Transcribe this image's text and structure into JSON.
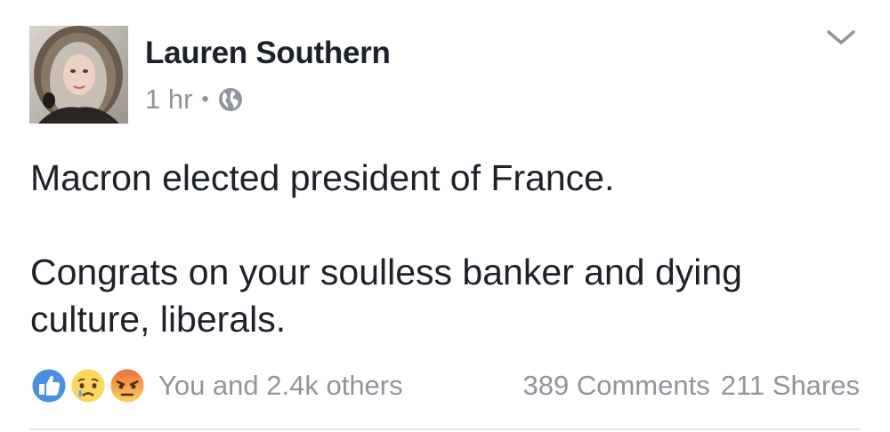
{
  "post": {
    "author": "Lauren Southern",
    "timestamp": "1 hr",
    "separator": "•",
    "audience_icon": "globe-icon",
    "menu_icon": "chevron-down-icon",
    "paragraphs": [
      "Macron elected president of France.",
      "Congrats on your soulless banker and dying culture, liberals."
    ]
  },
  "reactions": {
    "types": [
      "like-icon",
      "sad-icon",
      "angry-icon"
    ],
    "summary": "You and 2.4k others",
    "comments": "389 Comments",
    "shares": "211 Shares"
  },
  "colors": {
    "like_blue": "#4a90e2",
    "emoji_yellow": "#fdd65c",
    "angry_red": "#f06a3a",
    "meta_gray": "#90949c",
    "text": "#1d2129"
  }
}
